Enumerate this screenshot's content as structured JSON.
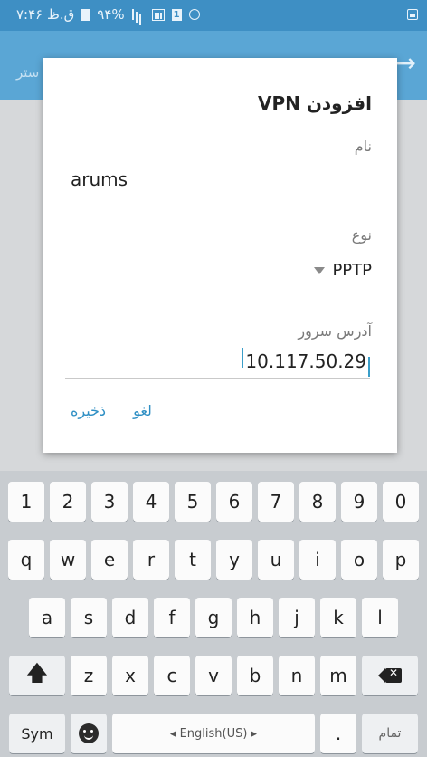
{
  "status_bar": {
    "time_text": "ق.ظ ۷:۴۶",
    "battery_text": "۹۴%",
    "sim_label": "1"
  },
  "dialog": {
    "title": "افزودن VPN",
    "name_label": "نام",
    "name_value": "arums",
    "type_label": "نوع",
    "type_value": "PPTP",
    "server_label": "آدرس سرور",
    "server_value": "10.117.50.29",
    "cancel_label": "لغو",
    "save_label": "ذخیره"
  },
  "app_bar": {
    "partial_text": "ستر"
  },
  "keyboard": {
    "row1": [
      "1",
      "2",
      "3",
      "4",
      "5",
      "6",
      "7",
      "8",
      "9",
      "0"
    ],
    "row2": [
      "q",
      "w",
      "e",
      "r",
      "t",
      "y",
      "u",
      "i",
      "o",
      "p"
    ],
    "row3": [
      "a",
      "s",
      "d",
      "f",
      "g",
      "h",
      "j",
      "k",
      "l"
    ],
    "row4": [
      "z",
      "x",
      "c",
      "v",
      "b",
      "n",
      "m"
    ],
    "sym_label": "Sym",
    "space_label": "◂ English(US) ▸",
    "dot_label": ".",
    "done_label": "تمام"
  },
  "colors": {
    "status_bar": "#3e8fc4",
    "app_bar": "#5aa6d5",
    "accent": "#2e8fc4"
  }
}
